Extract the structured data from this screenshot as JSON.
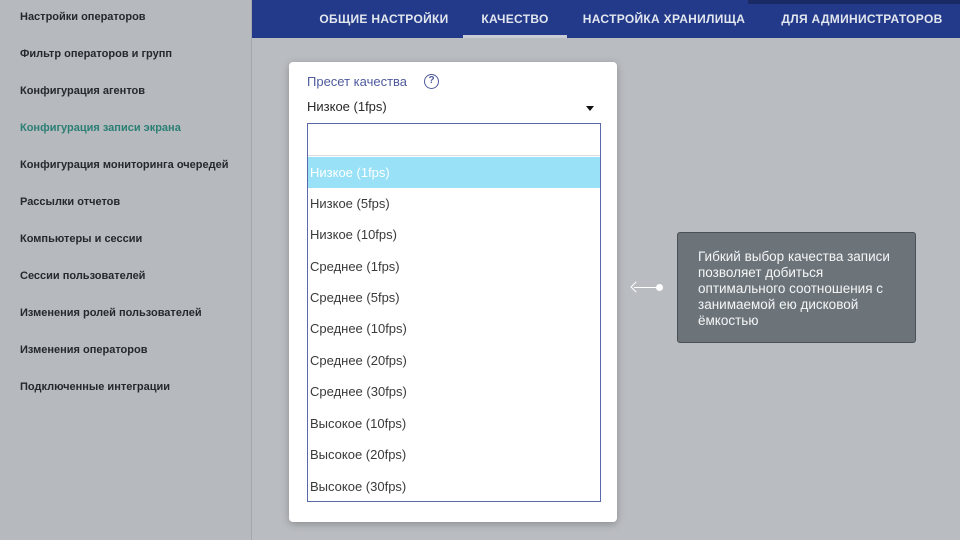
{
  "sidebar": {
    "items": [
      {
        "label": "Настройки операторов"
      },
      {
        "label": "Фильтр операторов и групп"
      },
      {
        "label": "Конфигурация агентов"
      },
      {
        "label": "Конфигурация записи экрана"
      },
      {
        "label": "Конфигурация мониторинга очередей"
      },
      {
        "label": "Рассылки отчетов"
      },
      {
        "label": "Компьютеры и сессии"
      },
      {
        "label": "Сессии пользователей"
      },
      {
        "label": "Изменения ролей пользователей"
      },
      {
        "label": "Изменения операторов"
      },
      {
        "label": "Подключенные интеграции"
      }
    ],
    "active_item": "Конфигурация записи экрана"
  },
  "tabs": [
    {
      "label": "ОБЩИЕ НАСТРОЙКИ"
    },
    {
      "label": "КАЧЕСТВО"
    },
    {
      "label": "НАСТРОЙКА ХРАНИЛИЩА"
    },
    {
      "label": "ДЛЯ АДМИНИСТРАТОРОВ"
    }
  ],
  "active_tab": "КАЧЕСТВО",
  "preset": {
    "label": "Пресет качества",
    "help_icon_glyph": "?",
    "value": "Низкое (1fps)",
    "search_value": "",
    "options": [
      {
        "label": "Низкое (1fps)"
      },
      {
        "label": "Низкое (5fps)"
      },
      {
        "label": "Низкое (10fps)"
      },
      {
        "label": "Среднее (1fps)"
      },
      {
        "label": "Среднее (5fps)"
      },
      {
        "label": "Среднее (10fps)"
      },
      {
        "label": "Среднее (20fps)"
      },
      {
        "label": "Среднее (30fps)"
      },
      {
        "label": "Высокое (10fps)"
      },
      {
        "label": "Высокое (20fps)"
      },
      {
        "label": "Высокое (30fps)"
      }
    ]
  },
  "callout": {
    "text": "Гибкий выбор качества записи позволяет добиться оптимального соотношения с занимаемой ею дисковой ёмкостью"
  },
  "colors": {
    "nav_bg": "#233a8a",
    "active_sidebar": "#2b7f74",
    "selected_option": "#98e1f6",
    "callout_bg": "#6d7479"
  }
}
